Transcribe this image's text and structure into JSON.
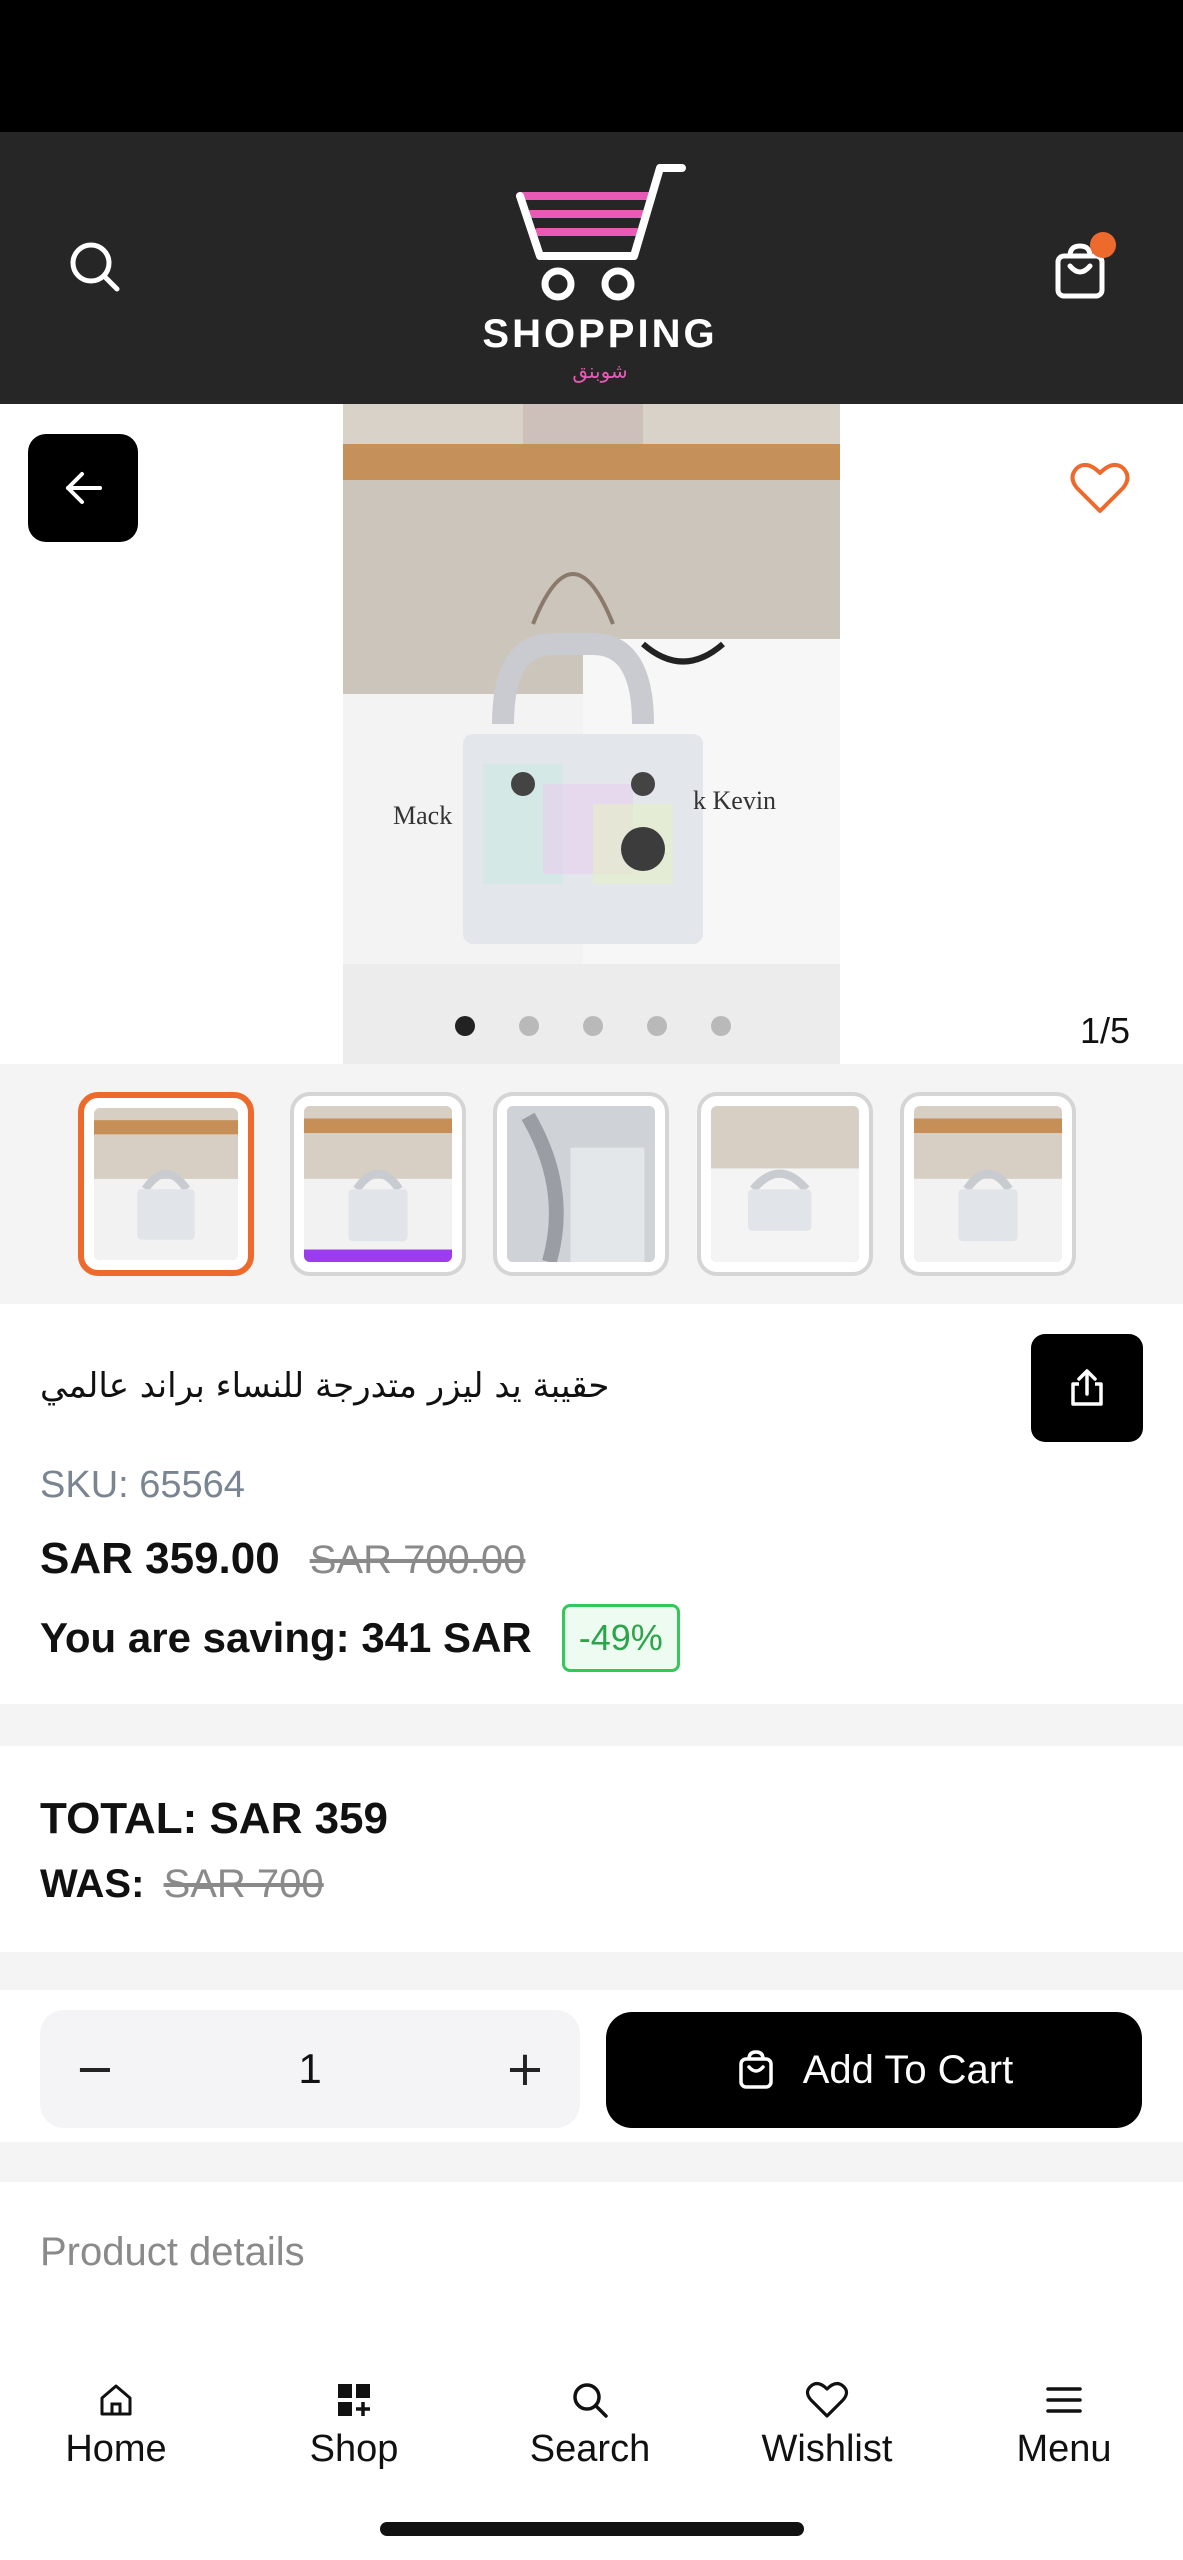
{
  "header": {
    "brand": "SHOPPING",
    "brand_sub": "شوبنق",
    "search_icon": "search-icon",
    "cart_icon": "shopping-bag-icon",
    "accent": "#ee6a2c",
    "logo_color": "#e85ab5"
  },
  "gallery": {
    "counter": "1/5",
    "total_images": 5,
    "active_index": 1,
    "back_icon": "arrow-left-icon",
    "wishlist_icon": "heart-icon"
  },
  "product": {
    "title": "حقيبة يد ليزر متدرجة للنساء براند عالمي",
    "sku": "SKU: 65564",
    "price": "SAR 359.00",
    "old_price": "SAR 700.00",
    "saving": "You are saving: 341 SAR",
    "discount": "-49%",
    "share_icon": "share-icon"
  },
  "totals": {
    "total": "TOTAL: SAR 359",
    "was_label": "WAS:",
    "was_value": "SAR 700"
  },
  "cart": {
    "quantity": "1",
    "minus": "−",
    "plus": "+",
    "add_label": "Add To Cart"
  },
  "details": {
    "label": "Product details"
  },
  "nav": {
    "items": [
      {
        "label": "Home",
        "icon": "home-icon"
      },
      {
        "label": "Shop",
        "icon": "grid-icon"
      },
      {
        "label": "Search",
        "icon": "search-icon"
      },
      {
        "label": "Wishlist",
        "icon": "heart-icon"
      },
      {
        "label": "Menu",
        "icon": "menu-icon"
      }
    ]
  }
}
